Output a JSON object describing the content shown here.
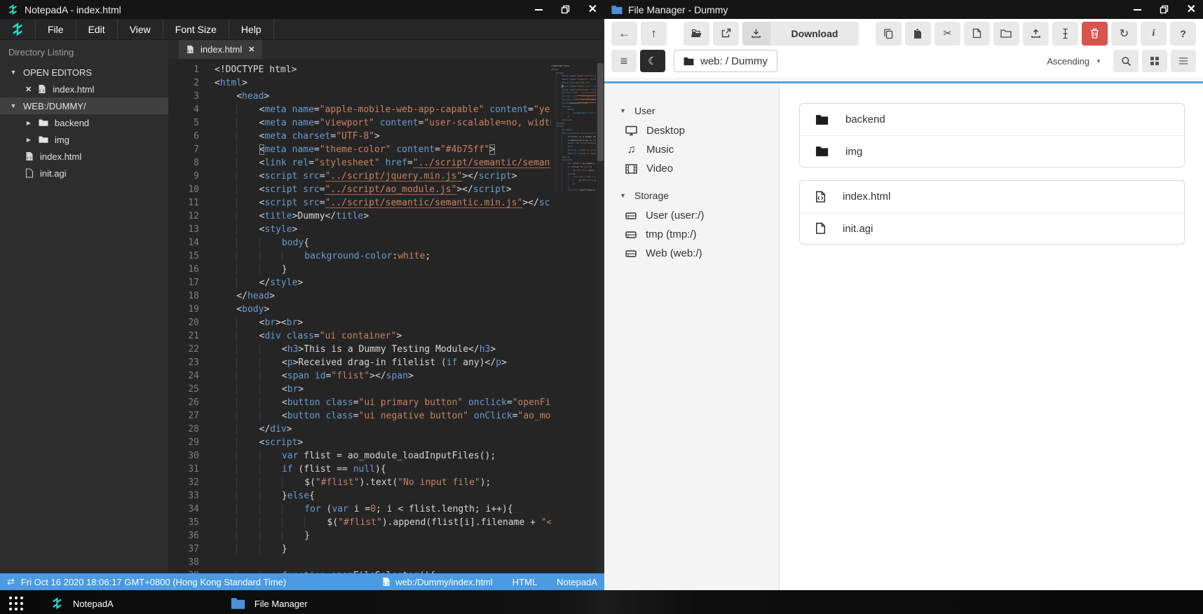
{
  "notepad": {
    "title": "NotepadA - index.html",
    "menu": [
      "File",
      "Edit",
      "View",
      "Font Size",
      "Help"
    ],
    "sidebar": {
      "header": "Directory Listing",
      "open_editors_label": "OPEN EDITORS",
      "open_editor_file": "index.html",
      "root_label": "WEB:/DUMMY/",
      "tree": [
        {
          "name": "backend",
          "type": "folder"
        },
        {
          "name": "img",
          "type": "folder"
        },
        {
          "name": "index.html",
          "type": "file"
        },
        {
          "name": "init.agi",
          "type": "file"
        }
      ]
    },
    "tab": "index.html",
    "editor_lines": [
      "<!DOCTYPE html>",
      "<html>",
      "    <head>",
      "        <meta name=\"apple-mobile-web-app-capable\" content=\"yes\">",
      "        <meta name=\"viewport\" content=\"user-scalable=no, width=device-width\">",
      "        <meta charset=\"UTF-8\">",
      "        <meta name=\"theme-color\" content=\"#4b75ff\">",
      "        <link rel=\"stylesheet\" href=\"../script/semantic/semantic.min.css\">",
      "        <script src=\"../script/jquery.min.js\"></script>",
      "        <script src=\"../script/ao_module.js\"></script>",
      "        <script src=\"../script/semantic/semantic.min.js\"></script>",
      "        <title>Dummy</title>",
      "        <style>",
      "            body{",
      "                background-color:white;",
      "            }",
      "        </style>",
      "    </head>",
      "    <body>",
      "        <br><br>",
      "        <div class=\"ui container\">",
      "            <h3>This is a Dummy Testing Module</h3>",
      "            <p>Received drag-in filelist (if any)</p>",
      "            <span id=\"flist\"></span>",
      "            <br>",
      "            <button class=\"ui primary button\" onclick=\"openFileSelector()\">",
      "            <button class=\"ui negative button\" onClick=\"ao_module_close()\">",
      "        </div>",
      "        <script>",
      "            var flist = ao_module_loadInputFiles();",
      "            if (flist == null){",
      "                $(\"#flist\").text(\"No input file\");",
      "            }else{",
      "                for (var i =0; i < flist.length; i++){",
      "                    $(\"#flist\").append(flist[i].filename + \"<br>\");",
      "                }",
      "            }",
      "",
      "            function openFileSelector(){"
    ],
    "statusbar": {
      "datetime": "Fri Oct 16 2020 18:06:17 GMT+0800 (Hong Kong Standard Time)",
      "file_path": "web:/Dummy/index.html",
      "language": "HTML",
      "app_name": "NotepadA"
    }
  },
  "filemanager": {
    "title": "File Manager - Dummy",
    "toolbar": {
      "download_label": "Download"
    },
    "breadcrumb": "web: / Dummy",
    "sort_order": "Ascending",
    "sidebar": {
      "sections": [
        {
          "label": "User",
          "items": [
            {
              "icon": "desktop-icon",
              "label": "Desktop"
            },
            {
              "icon": "music-icon",
              "label": "Music"
            },
            {
              "icon": "video-icon",
              "label": "Video"
            }
          ]
        },
        {
          "label": "Storage",
          "items": [
            {
              "icon": "hdd-icon",
              "label": "User (user:/)"
            },
            {
              "icon": "hdd-icon",
              "label": "tmp (tmp:/)"
            },
            {
              "icon": "hdd-icon",
              "label": "Web (web:/)"
            }
          ]
        }
      ]
    },
    "file_groups": [
      {
        "items": [
          {
            "icon": "folder",
            "name": "backend"
          },
          {
            "icon": "folder",
            "name": "img"
          }
        ]
      },
      {
        "items": [
          {
            "icon": "file-code",
            "name": "index.html"
          },
          {
            "icon": "file",
            "name": "init.agi"
          }
        ]
      }
    ]
  },
  "taskbar": {
    "items": [
      {
        "label": "NotepadA"
      },
      {
        "label": "File Manager"
      }
    ]
  },
  "icons": {
    "back": "←",
    "up": "↑",
    "cut": "✂",
    "refresh": "↻",
    "info": "i",
    "help": "?",
    "hamburger": "≡",
    "moon": "☾",
    "swap": "⇄",
    "close": "✕",
    "caret_down": "▼",
    "caret_right": "▶",
    "sort_caret": "▼",
    "music": "♫"
  }
}
